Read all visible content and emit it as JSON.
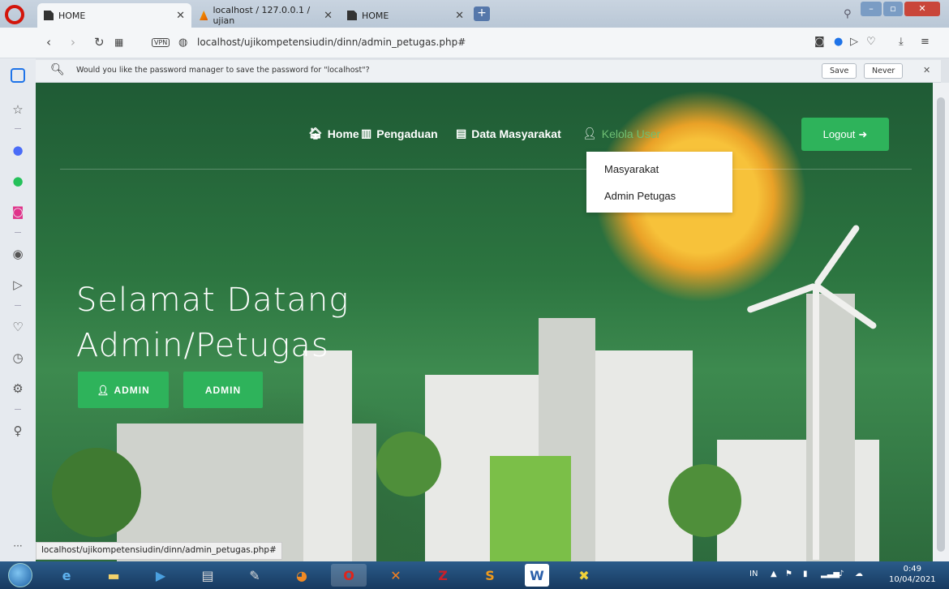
{
  "browser": {
    "tabs": [
      {
        "label": "HOME",
        "icon": "document-icon",
        "active": true
      },
      {
        "label": "localhost / 127.0.0.1 / ujian",
        "icon": "phpmyadmin-icon",
        "active": false
      },
      {
        "label": "HOME",
        "icon": "document-icon",
        "active": false
      }
    ],
    "url": "localhost/ujikompetensiudin/dinn/admin_petugas.php#",
    "vpn_label": "VPN",
    "password_prompt": {
      "message": "Would you like the password manager to save the password for \"localhost\"?",
      "save_label": "Save",
      "never_label": "Never"
    },
    "status_url": "localhost/ujikompetensiudin/dinn/admin_petugas.php#"
  },
  "nav": {
    "home": "Home",
    "pengaduan": "Pengaduan",
    "data_masyarakat": "Data Masyarakat",
    "kelola_user": "Kelola User",
    "logout": "Logout"
  },
  "dropdown": {
    "items": [
      "Masyarakat",
      "Admin Petugas"
    ]
  },
  "hero": {
    "line1": "Selamat Datang",
    "line2": "Admin/Petugas",
    "buttons": [
      "ADMIN",
      "ADMIN"
    ]
  },
  "taskbar": {
    "lang": "IN",
    "time": "0:49",
    "date": "10/04/2021"
  },
  "colors": {
    "accent_green": "#2eb35b",
    "opera_red": "#d3150b"
  }
}
